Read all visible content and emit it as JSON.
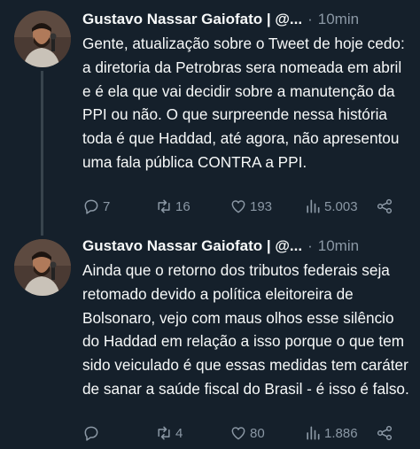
{
  "tweets": [
    {
      "author": "Gustavo Nassar Gaiofato | @...",
      "separator": "·",
      "time": "10min",
      "text": "Gente, atualização sobre o Tweet de hoje cedo: a diretoria da Petrobras sera nomeada em abril e é ela que vai decidir sobre a manutenção da PPI ou não. O que surpreende nessa história toda é que Haddad, até agora, não apresentou uma fala pública CONTRA a PPI.",
      "replies": "7",
      "retweets": "16",
      "likes": "193",
      "views": "5.003"
    },
    {
      "author": "Gustavo Nassar Gaiofato | @...",
      "separator": "·",
      "time": "10min",
      "text": "Ainda que o retorno dos tributos federais seja retomado devido a política eleitoreira de Bolsonaro, vejo com maus olhos esse silêncio do Haddad em relação a isso porque o que tem sido veiculado é que essas medidas tem caráter de sanar a saúde fiscal do Brasil - é isso é falso.",
      "replies": "",
      "retweets": "4",
      "likes": "80",
      "views": "1.886"
    }
  ],
  "icons": {
    "reply": "reply-icon",
    "retweet": "retweet-icon",
    "like": "like-icon",
    "views": "views-icon",
    "share": "share-icon"
  },
  "colors": {
    "background": "#15202b",
    "text": "#f7f9f9",
    "secondary": "#8b98a5",
    "thread_line": "#38444d"
  }
}
